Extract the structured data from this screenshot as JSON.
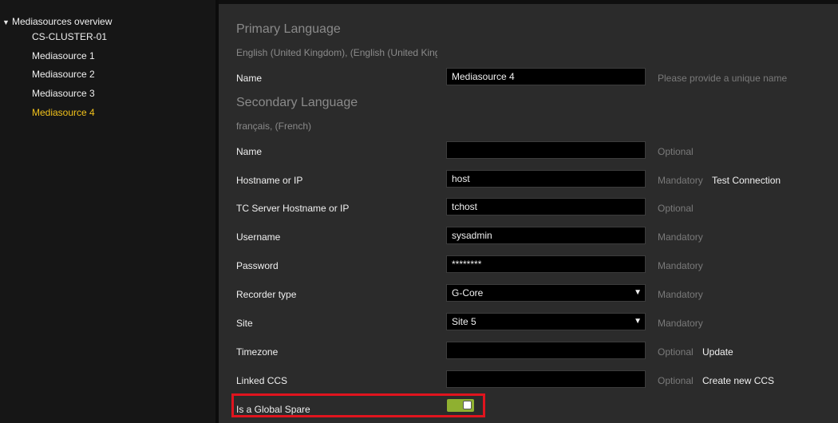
{
  "sidebar": {
    "root_label": "Mediasources overview",
    "items": [
      {
        "label": "CS-CLUSTER-01"
      },
      {
        "label": "Mediasource 1"
      },
      {
        "label": "Mediasource 2"
      },
      {
        "label": "Mediasource 3"
      },
      {
        "label": "Mediasource 4"
      }
    ],
    "active_color": "#f2c21b"
  },
  "form": {
    "primary": {
      "title": "Primary Language",
      "language": "English (United Kingdom), (English (United Kingdom))",
      "name_label": "Name",
      "name_value": "Mediasource 4",
      "name_hint": "Please provide a unique name"
    },
    "secondary": {
      "title": "Secondary Language",
      "language": "français, (French)",
      "name_label": "Name",
      "name_value": "",
      "name_hint": "Optional"
    },
    "hostname": {
      "label": "Hostname or IP",
      "value": "host",
      "hint": "Mandatory",
      "action": "Test Connection"
    },
    "tc_hostname": {
      "label": "TC Server Hostname or IP",
      "value": "tchost",
      "hint": "Optional"
    },
    "username": {
      "label": "Username",
      "value": "sysadmin",
      "hint": "Mandatory"
    },
    "password": {
      "label": "Password",
      "value": "********",
      "hint": "Mandatory"
    },
    "recorder_type": {
      "label": "Recorder type",
      "value": "G-Core",
      "hint": "Mandatory"
    },
    "site": {
      "label": "Site",
      "value": "Site 5",
      "hint": "Mandatory"
    },
    "timezone": {
      "label": "Timezone",
      "value": "",
      "hint": "Optional",
      "action": "Update"
    },
    "linked_ccs": {
      "label": "Linked CCS",
      "value": "",
      "hint": "Optional",
      "action": "Create new CCS"
    },
    "global_spare": {
      "label": "Is a Global Spare",
      "on": true,
      "toggle_color": "#8fb030",
      "highlight_color": "#e0141e"
    }
  }
}
